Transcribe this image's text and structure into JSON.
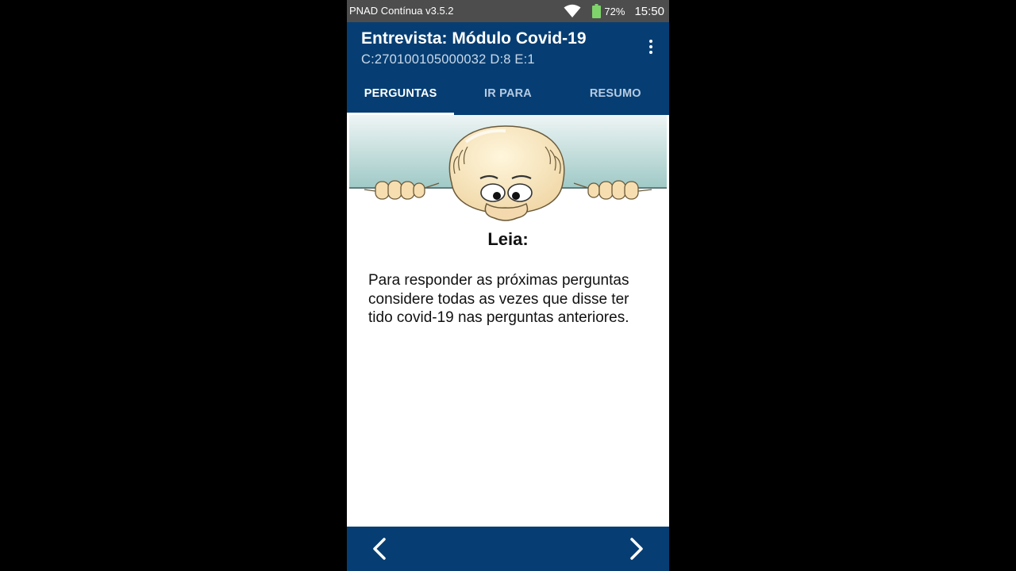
{
  "status_bar": {
    "app_version": "PNAD Contínua v3.5.2",
    "battery_percent": "72%",
    "time": "15:50",
    "icons": [
      "wifi-icon",
      "battery-icon"
    ]
  },
  "app_bar": {
    "title": "Entrevista: Módulo Covid-19",
    "subtitle": "C:270100105000032 D:8 E:1",
    "menu_icon": "more-vert-icon"
  },
  "tabs": [
    {
      "label": "PERGUNTAS",
      "active": true
    },
    {
      "label": "IR PARA",
      "active": false
    },
    {
      "label": "RESUMO",
      "active": false
    }
  ],
  "content": {
    "heading": "Leia:",
    "paragraph": "Para responder as próximas perguntas considere todas as vezes que disse ter tido covid-19 nas perguntas anteriores."
  },
  "navigation": {
    "prev_icon": "chevron-left-icon",
    "next_icon": "chevron-right-icon"
  },
  "colors": {
    "primary": "#063e73",
    "status_bar": "#4d4d4d",
    "background": "#000000",
    "tab_inactive": "#b7cbe2"
  }
}
